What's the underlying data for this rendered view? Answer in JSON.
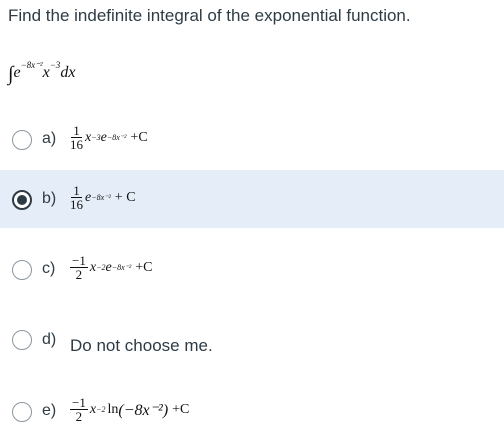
{
  "question": "Find the indefinite integral of the exponential function.",
  "integral": {
    "sign": "∫",
    "base_e": "e",
    "exp": "−8x⁻²",
    "x": "x",
    "x_exp": "−3",
    "dx": "dx"
  },
  "options": [
    {
      "letter": "a)",
      "num": "1",
      "den": "16",
      "body": "x",
      "body_exp": "−3",
      "e": "e",
      "e_exp": "−8x⁻²",
      "tail": "+C",
      "selected": false
    },
    {
      "letter": "b)",
      "num": "1",
      "den": "16",
      "e": "e",
      "e_exp": "−8x⁻²",
      "tail": "+ C",
      "selected": true
    },
    {
      "letter": "c)",
      "num": "−1",
      "den": "2",
      "body": "x",
      "body_exp": "−2",
      "e": "e",
      "e_exp": "−8x⁻²",
      "tail": "+C",
      "selected": false
    },
    {
      "letter": "d)",
      "text": "Do not choose me.",
      "selected": false
    },
    {
      "letter": "e)",
      "num": "−1",
      "den": "2",
      "body": "x",
      "body_exp": "−2",
      "ln": "ln",
      "ln_arg": "(−8x⁻²)",
      "tail": "+C",
      "selected": false
    }
  ]
}
